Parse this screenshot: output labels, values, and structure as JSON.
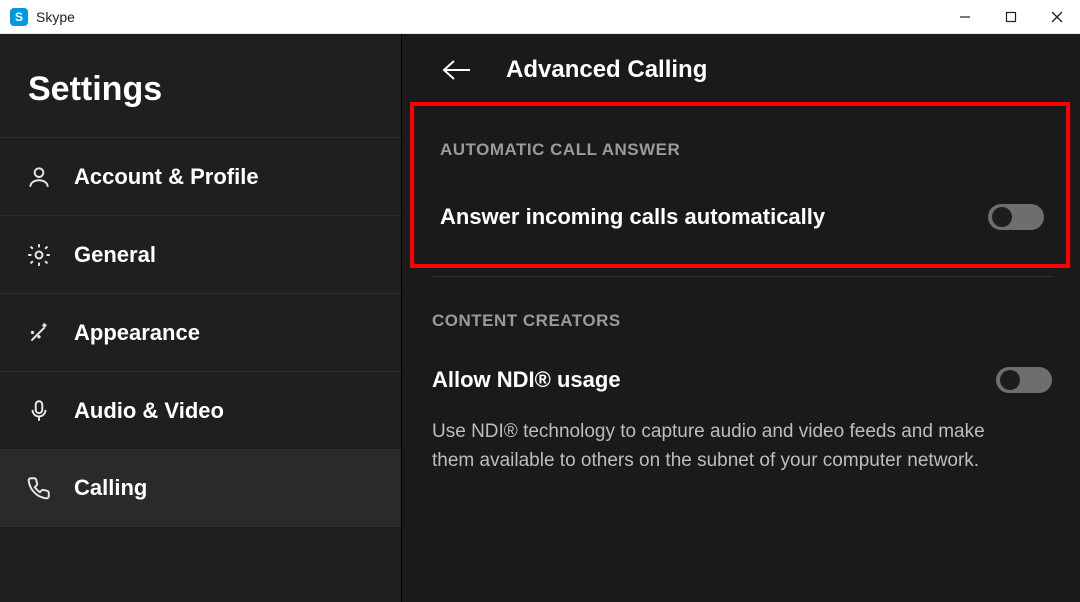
{
  "window": {
    "title": "Skype",
    "logo_letter": "S"
  },
  "sidebar": {
    "title": "Settings",
    "items": [
      {
        "id": "account",
        "label": "Account & Profile",
        "icon": "user-icon",
        "active": false
      },
      {
        "id": "general",
        "label": "General",
        "icon": "gear-icon",
        "active": false
      },
      {
        "id": "appearance",
        "label": "Appearance",
        "icon": "wand-icon",
        "active": false
      },
      {
        "id": "audio-video",
        "label": "Audio & Video",
        "icon": "mic-icon",
        "active": false
      },
      {
        "id": "calling",
        "label": "Calling",
        "icon": "phone-icon",
        "active": true
      }
    ]
  },
  "main": {
    "title": "Advanced Calling",
    "section_auto": {
      "label": "AUTOMATIC CALL ANSWER",
      "setting_label": "Answer incoming calls automatically",
      "toggle_on": false
    },
    "section_creators": {
      "label": "CONTENT CREATORS",
      "ndi_label": "Allow NDI® usage",
      "ndi_toggle_on": false,
      "ndi_description": "Use NDI® technology to capture audio and video feeds and make them available to others on the subnet of your computer network."
    }
  },
  "annotation": {
    "highlight_color": "#ff0000"
  }
}
